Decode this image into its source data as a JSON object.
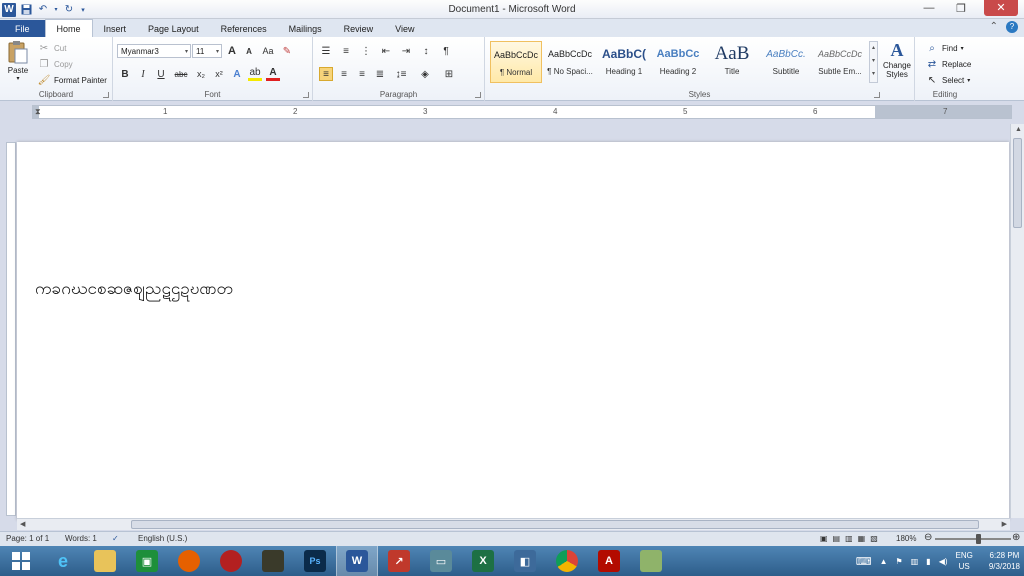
{
  "window": {
    "title": "Document1 - Microsoft Word",
    "qat": {
      "logo_letter": "W",
      "save_icon": "save-icon",
      "undo_icon": "undo-icon",
      "redo_icon": "redo-icon"
    },
    "controls": {
      "minimize": "—",
      "maximize": "❐",
      "close": "✕"
    }
  },
  "tabs": [
    "File",
    "Home",
    "Insert",
    "Page Layout",
    "References",
    "Mailings",
    "Review",
    "View"
  ],
  "active_tab": "Home",
  "clipboard": {
    "label": "Clipboard",
    "paste": "Paste",
    "cut": "Cut",
    "copy": "Copy",
    "format_painter": "Format Painter"
  },
  "font": {
    "label": "Font",
    "family": "Myanmar3",
    "size": "11",
    "grow": "A",
    "shrink": "A",
    "case": "Aa",
    "bold": "B",
    "italic": "I",
    "underline": "U",
    "strike": "abc",
    "subscript": "x₂",
    "superscript": "x²",
    "text_effects": "A",
    "font_color": "A",
    "font_color_hex": "#e02020",
    "highlight_hex": "#f5e900"
  },
  "paragraph": {
    "label": "Paragraph",
    "pilcrow": "¶"
  },
  "styles": {
    "label": "Styles",
    "items": [
      {
        "sample": "AaBbCcDc",
        "name": "¶ Normal"
      },
      {
        "sample": "AaBbCcDc",
        "name": "¶ No Spaci..."
      },
      {
        "sample": "AaBbC(",
        "name": "Heading 1"
      },
      {
        "sample": "AaBbCc",
        "name": "Heading 2"
      },
      {
        "sample": "AaB",
        "name": "Title"
      },
      {
        "sample": "AaBbCc.",
        "name": "Subtitle"
      },
      {
        "sample": "AaBbCcDc",
        "name": "Subtle Em..."
      }
    ],
    "change_styles": "Change Styles"
  },
  "editing": {
    "label": "Editing",
    "find": "Find",
    "replace": "Replace",
    "select": "Select"
  },
  "ruler": {
    "numbers": [
      "1",
      "1",
      "2",
      "3",
      "4",
      "5",
      "6",
      "7"
    ]
  },
  "document": {
    "text": "ကခဂဃငစဆဇဈညဋဌဍဎဏတ"
  },
  "status": {
    "page": "Page: 1 of 1",
    "words": "Words: 1",
    "language": "English (U.S.)",
    "zoom": "180%"
  },
  "taskbar": {
    "items": [
      "start",
      "ie",
      "explorer",
      "store",
      "firefox",
      "app-red",
      "app-dark",
      "photoshop",
      "word",
      "app-chart",
      "app-monitor",
      "excel",
      "app-film",
      "chrome",
      "acrobat",
      "app-green"
    ],
    "active": "word",
    "lang_top": "ENG",
    "lang_bottom": "US",
    "time": "6:28 PM",
    "date": "9/3/2018"
  }
}
